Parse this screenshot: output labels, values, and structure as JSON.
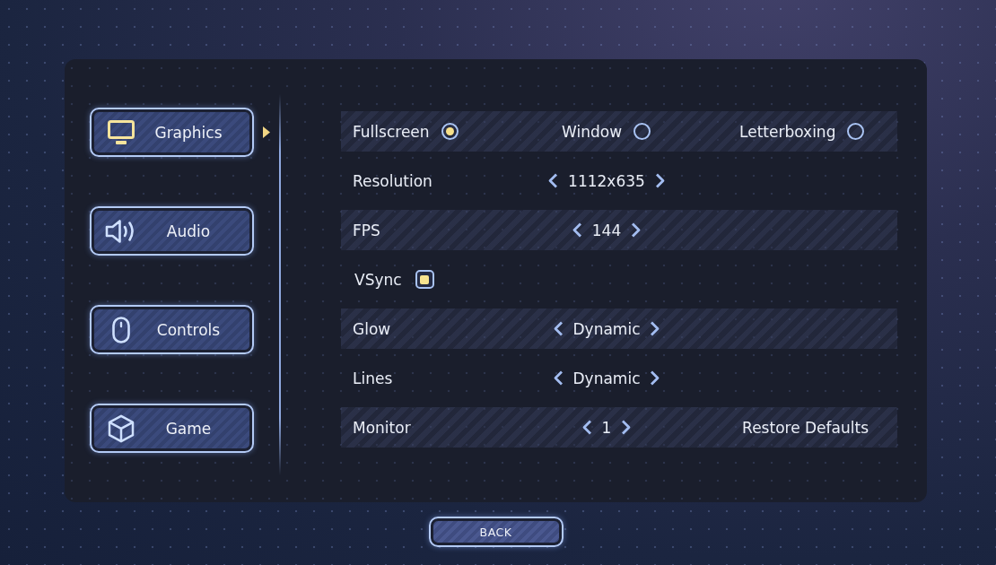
{
  "tabs": [
    {
      "label": "Graphics",
      "selected": true
    },
    {
      "label": "Audio",
      "selected": false
    },
    {
      "label": "Controls",
      "selected": false
    },
    {
      "label": "Game",
      "selected": false
    }
  ],
  "settings": [
    {
      "kind": "radio",
      "options": [
        {
          "label": "Fullscreen",
          "selected": true
        },
        {
          "label": "Window",
          "selected": false
        },
        {
          "label": "Letterboxing",
          "selected": false
        }
      ]
    },
    {
      "kind": "selector",
      "label": "Resolution",
      "value": "1112x635"
    },
    {
      "kind": "selector",
      "label": "FPS",
      "value": "144"
    },
    {
      "kind": "checkbox",
      "label": "VSync",
      "checked": true
    },
    {
      "kind": "selector",
      "label": "Glow",
      "value": "Dynamic"
    },
    {
      "kind": "selector",
      "label": "Lines",
      "value": "Dynamic"
    },
    {
      "kind": "selector",
      "label": "Monitor",
      "value": "1",
      "action": "Restore Defaults"
    }
  ],
  "back_button": "BACK"
}
